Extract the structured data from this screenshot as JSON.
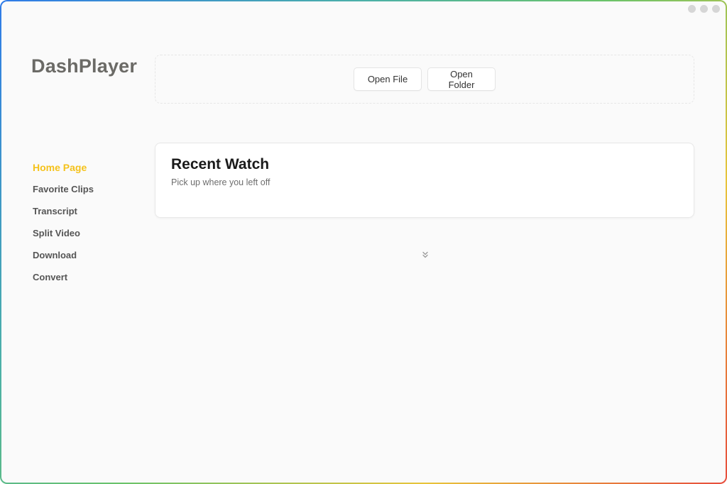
{
  "app": {
    "title": "DashPlayer"
  },
  "window_controls": [
    "minimize-dot",
    "maximize-dot",
    "close-dot"
  ],
  "toolbar": {
    "open_file_label": "Open File",
    "open_folder_label": "Open Folder"
  },
  "sidebar": {
    "items": [
      {
        "label": "Home Page",
        "active": true
      },
      {
        "label": "Favorite Clips",
        "active": false
      },
      {
        "label": "Transcript",
        "active": false
      },
      {
        "label": "Split Video",
        "active": false
      },
      {
        "label": "Download",
        "active": false
      },
      {
        "label": "Convert",
        "active": false
      }
    ]
  },
  "recent": {
    "title": "Recent Watch",
    "subtitle": "Pick up where you left off"
  },
  "icons": {
    "expand": "chevrons-down-icon"
  },
  "colors": {
    "accent": "#f5c21b",
    "text": "#555555",
    "background": "#fafafa"
  }
}
